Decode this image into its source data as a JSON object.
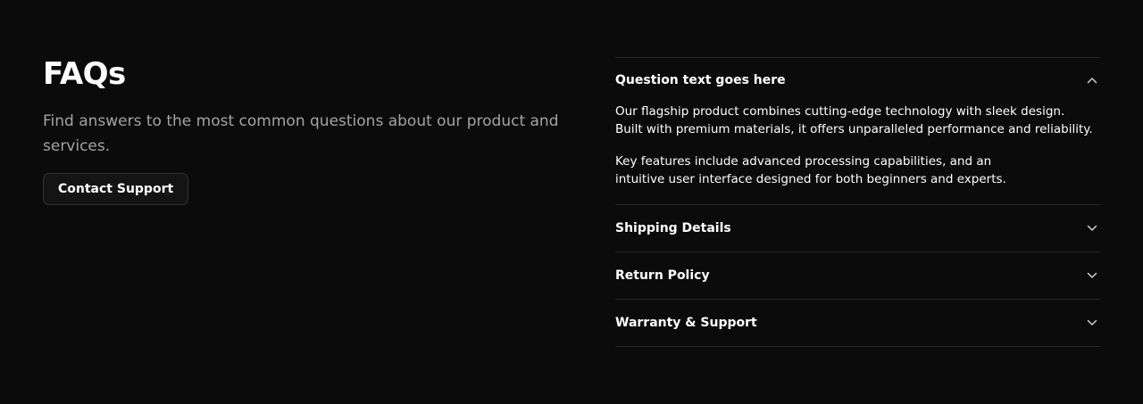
{
  "faq_section": {
    "title": "FAQs",
    "subtitle": "Find answers to the most common questions about our product and services.",
    "contact_button_label": "Contact Support"
  },
  "faq_items": [
    {
      "question": "Question text goes here",
      "expanded": true,
      "answer_lines": [
        "Our flagship product combines cutting-edge technology with sleek design.",
        "Built with premium materials, it offers unparalleled performance and reliability."
      ],
      "answer_lines_2": [
        "Key features include advanced processing capabilities, and an",
        "intuitive user interface designed for both beginners and experts."
      ]
    },
    {
      "question": "Shipping Details",
      "expanded": false
    },
    {
      "question": "Return Policy",
      "expanded": false
    },
    {
      "question": "Warranty & Support",
      "expanded": false
    }
  ],
  "icons": {
    "expanded": "chevron-up-icon",
    "collapsed": "chevron-down-icon"
  },
  "colors": {
    "background": "#0b0b0b",
    "text": "#ffffff",
    "muted_text": "#a3a3a3",
    "divider": "#262626"
  }
}
